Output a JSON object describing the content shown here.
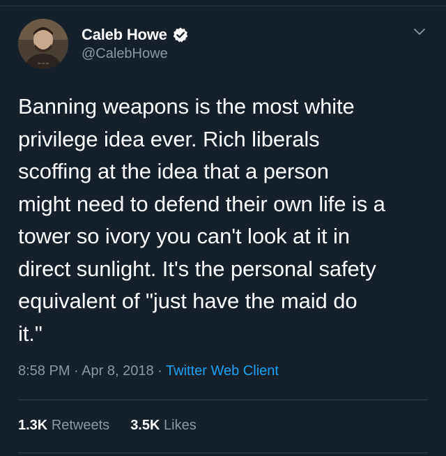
{
  "tweet": {
    "author": {
      "display_name": "Caleb Howe",
      "handle": "@CalebHowe",
      "verified": true,
      "avatar_icon": "user-avatar-photo"
    },
    "text": "Banning weapons is the most white\nprivilege idea ever. Rich liberals\nscoffing at the idea that a person\nmight need to defend their own life is a\ntower so ivory you can't look at it in\ndirect sunlight. It's the personal safety\nequivalent of \"just have the maid do\nit.\"",
    "time": "8:58 PM",
    "separator": "·",
    "date": "Apr 8, 2018",
    "client": "Twitter Web Client",
    "stats": {
      "retweets_count": "1.3K",
      "retweets_label": "Retweets",
      "likes_count": "3.5K",
      "likes_label": "Likes"
    }
  },
  "colors": {
    "background": "#15202b",
    "secondary_text": "#8899a6",
    "link": "#1da1f2",
    "divider": "#38444d"
  },
  "icons": {
    "verified": "verified-badge-icon",
    "menu": "chevron-down-icon"
  }
}
